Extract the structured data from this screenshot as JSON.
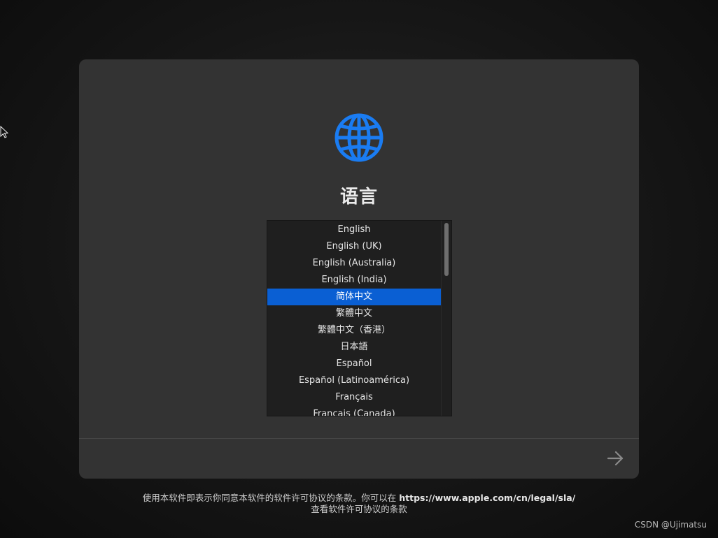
{
  "page": {
    "title": "语言"
  },
  "languages": {
    "items": [
      {
        "label": "English",
        "selected": false
      },
      {
        "label": "English (UK)",
        "selected": false
      },
      {
        "label": "English (Australia)",
        "selected": false
      },
      {
        "label": "English (India)",
        "selected": false
      },
      {
        "label": "简体中文",
        "selected": true
      },
      {
        "label": "繁體中文",
        "selected": false
      },
      {
        "label": "繁體中文（香港）",
        "selected": false
      },
      {
        "label": "日本語",
        "selected": false
      },
      {
        "label": "Español",
        "selected": false
      },
      {
        "label": "Español (Latinoamérica)",
        "selected": false
      },
      {
        "label": "Français",
        "selected": false
      },
      {
        "label": "Français (Canada)",
        "selected": false
      }
    ]
  },
  "footer": {
    "line1_text": "使用本软件即表示你同意本软件的软件许可协议的条款。你可以在 ",
    "line1_link": "https://www.apple.com/cn/legal/sla/",
    "line2": "查看软件许可协议的条款"
  },
  "watermark": "CSDN @Ujimatsu",
  "icons": {
    "globe": "globe-icon",
    "next": "arrow-right-icon",
    "cursor": "mouse-pointer"
  },
  "colors": {
    "accent": "#0a5fd3",
    "globe": "#1a7cf2",
    "card": "#333333",
    "list_bg": "#1f1f1f"
  }
}
